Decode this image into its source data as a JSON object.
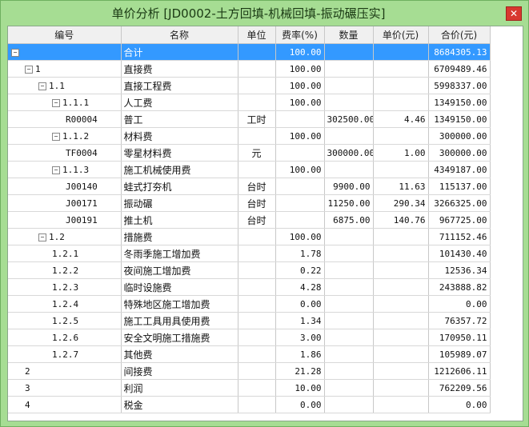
{
  "window": {
    "title": "单价分析 [JD0002-土方回填-机械回填-振动碾压实]"
  },
  "columns": [
    "编号",
    "名称",
    "单位",
    "费率(%)",
    "数量",
    "单价(元)",
    "合价(元)"
  ],
  "rows": [
    {
      "code": "",
      "name": "合计",
      "unit": "",
      "rate": "100.00",
      "qty": "",
      "price": "",
      "total": "8684305.13",
      "depth": 0,
      "toggle": "⊟",
      "selected": true
    },
    {
      "code": "1",
      "name": "直接费",
      "unit": "",
      "rate": "100.00",
      "qty": "",
      "price": "",
      "total": "6709489.46",
      "depth": 1,
      "toggle": "⊟"
    },
    {
      "code": "1.1",
      "name": "直接工程费",
      "unit": "",
      "rate": "100.00",
      "qty": "",
      "price": "",
      "total": "5998337.00",
      "depth": 2,
      "toggle": "⊟"
    },
    {
      "code": "1.1.1",
      "name": "人工费",
      "unit": "",
      "rate": "100.00",
      "qty": "",
      "price": "",
      "total": "1349150.00",
      "depth": 3,
      "toggle": "⊟"
    },
    {
      "code": "R00004",
      "name": "普工",
      "unit": "工时",
      "rate": "",
      "qty": "302500.00",
      "price": "4.46",
      "total": "1349150.00",
      "depth": 4,
      "toggle": ""
    },
    {
      "code": "1.1.2",
      "name": "材料费",
      "unit": "",
      "rate": "100.00",
      "qty": "",
      "price": "",
      "total": "300000.00",
      "depth": 3,
      "toggle": "⊟"
    },
    {
      "code": "TF0004",
      "name": "零星材料费",
      "unit": "元",
      "rate": "",
      "qty": "300000.00",
      "price": "1.00",
      "total": "300000.00",
      "depth": 4,
      "toggle": ""
    },
    {
      "code": "1.1.3",
      "name": "施工机械使用费",
      "unit": "",
      "rate": "100.00",
      "qty": "",
      "price": "",
      "total": "4349187.00",
      "depth": 3,
      "toggle": "⊟"
    },
    {
      "code": "J00140",
      "name": "蛙式打夯机",
      "unit": "台时",
      "rate": "",
      "qty": "9900.00",
      "price": "11.63",
      "total": "115137.00",
      "depth": 4,
      "toggle": ""
    },
    {
      "code": "J00171",
      "name": "振动碾",
      "unit": "台时",
      "rate": "",
      "qty": "11250.00",
      "price": "290.34",
      "total": "3266325.00",
      "depth": 4,
      "toggle": ""
    },
    {
      "code": "J00191",
      "name": "推土机",
      "unit": "台时",
      "rate": "",
      "qty": "6875.00",
      "price": "140.76",
      "total": "967725.00",
      "depth": 4,
      "toggle": ""
    },
    {
      "code": "1.2",
      "name": "措施费",
      "unit": "",
      "rate": "100.00",
      "qty": "",
      "price": "",
      "total": "711152.46",
      "depth": 2,
      "toggle": "⊟"
    },
    {
      "code": "1.2.1",
      "name": "冬雨季施工增加费",
      "unit": "",
      "rate": "1.78",
      "qty": "",
      "price": "",
      "total": "101430.40",
      "depth": 3,
      "toggle": ""
    },
    {
      "code": "1.2.2",
      "name": "夜间施工增加费",
      "unit": "",
      "rate": "0.22",
      "qty": "",
      "price": "",
      "total": "12536.34",
      "depth": 3,
      "toggle": ""
    },
    {
      "code": "1.2.3",
      "name": "临时设施费",
      "unit": "",
      "rate": "4.28",
      "qty": "",
      "price": "",
      "total": "243888.82",
      "depth": 3,
      "toggle": ""
    },
    {
      "code": "1.2.4",
      "name": "特殊地区施工增加费",
      "unit": "",
      "rate": "0.00",
      "qty": "",
      "price": "",
      "total": "0.00",
      "depth": 3,
      "toggle": ""
    },
    {
      "code": "1.2.5",
      "name": "施工工具用具使用费",
      "unit": "",
      "rate": "1.34",
      "qty": "",
      "price": "",
      "total": "76357.72",
      "depth": 3,
      "toggle": ""
    },
    {
      "code": "1.2.6",
      "name": "安全文明施工措施费",
      "unit": "",
      "rate": "3.00",
      "qty": "",
      "price": "",
      "total": "170950.11",
      "depth": 3,
      "toggle": ""
    },
    {
      "code": "1.2.7",
      "name": "其他费",
      "unit": "",
      "rate": "1.86",
      "qty": "",
      "price": "",
      "total": "105989.07",
      "depth": 3,
      "toggle": ""
    },
    {
      "code": "2",
      "name": "间接费",
      "unit": "",
      "rate": "21.28",
      "qty": "",
      "price": "",
      "total": "1212606.11",
      "depth": 1,
      "toggle": ""
    },
    {
      "code": "3",
      "name": "利润",
      "unit": "",
      "rate": "10.00",
      "qty": "",
      "price": "",
      "total": "762209.56",
      "depth": 1,
      "toggle": ""
    },
    {
      "code": "4",
      "name": "税金",
      "unit": "",
      "rate": "0.00",
      "qty": "",
      "price": "",
      "total": "0.00",
      "depth": 1,
      "toggle": ""
    }
  ]
}
